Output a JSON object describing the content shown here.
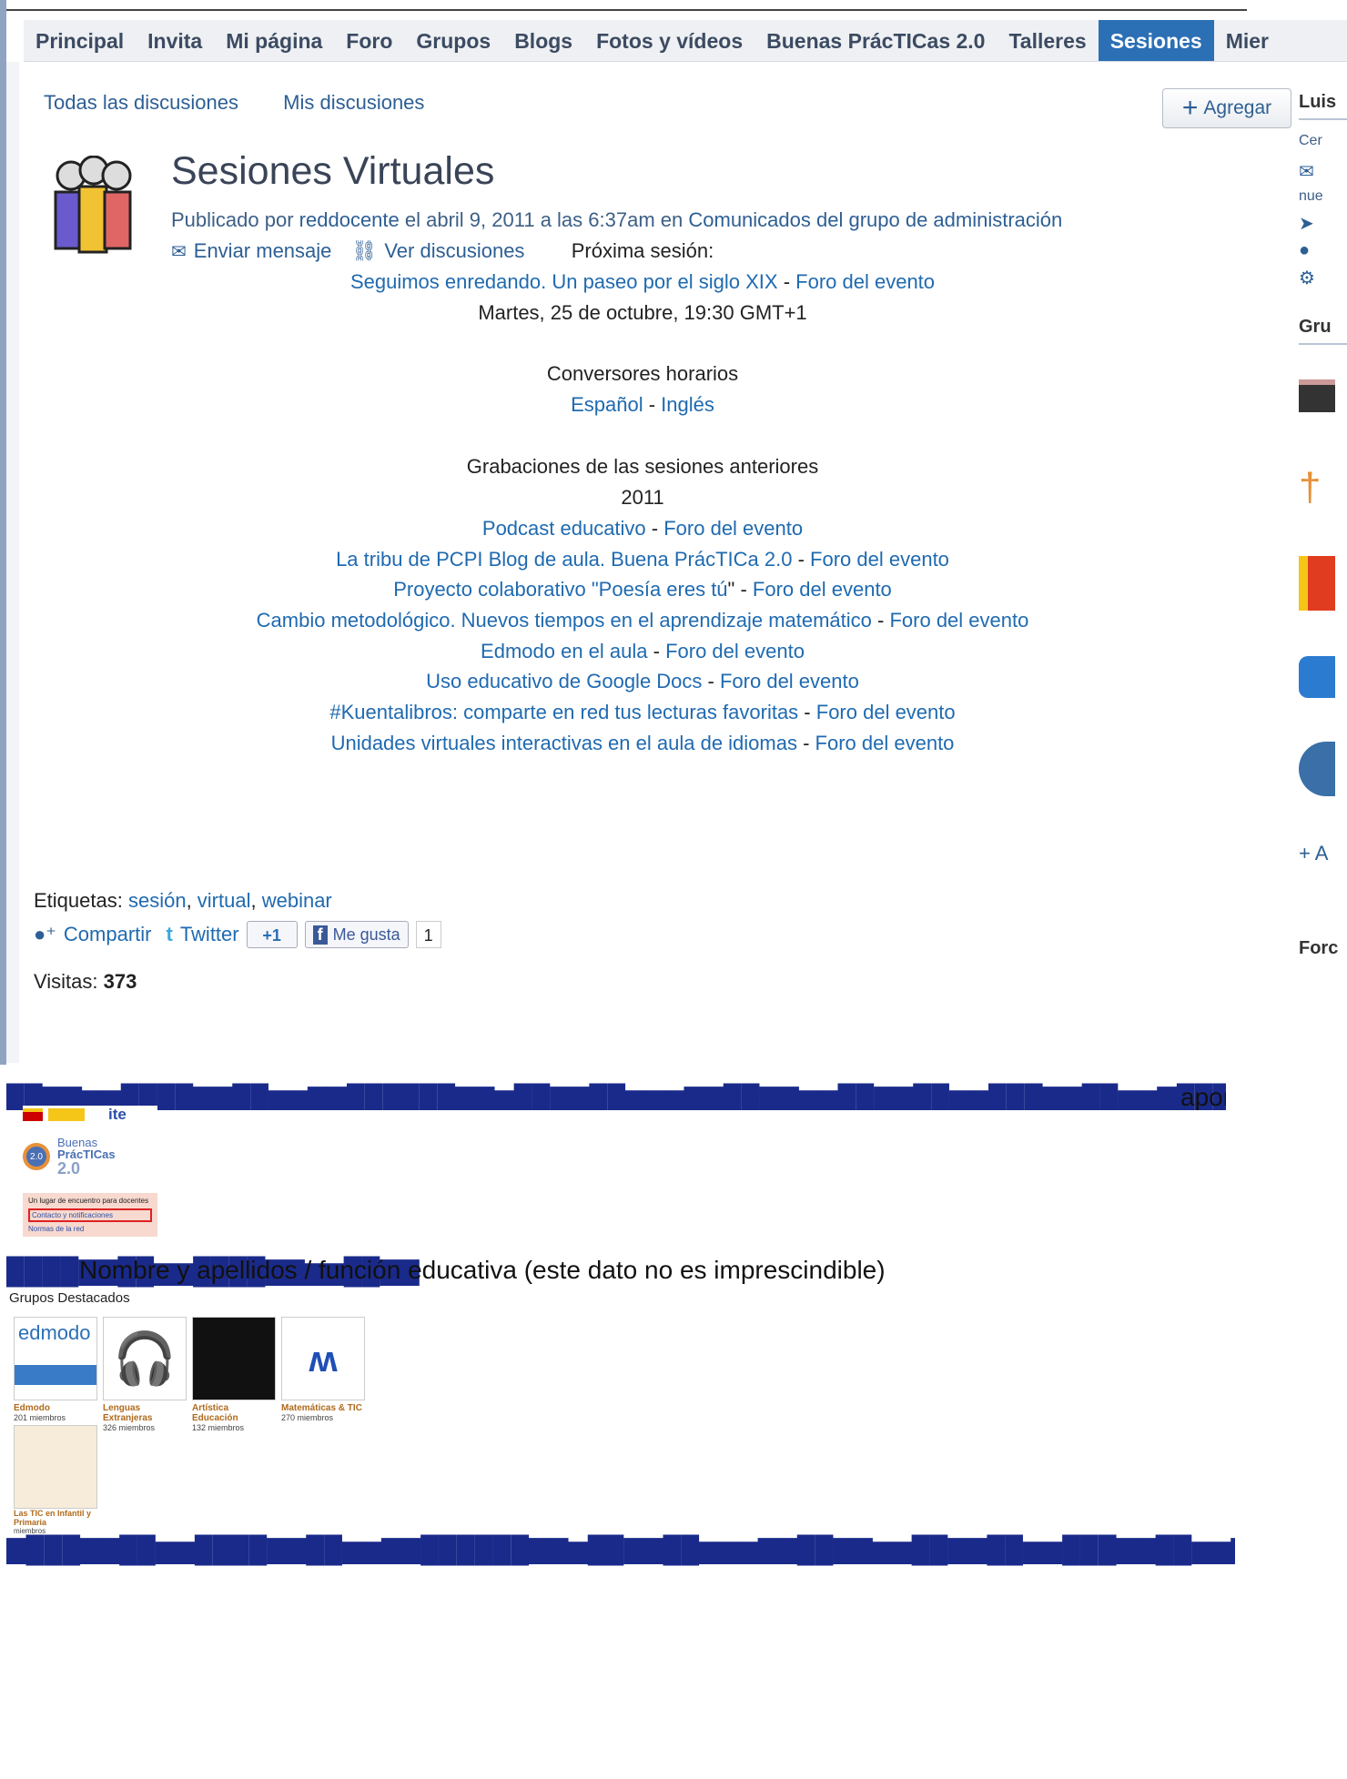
{
  "nav": [
    "Principal",
    "Invita",
    "Mi página",
    "Foro",
    "Grupos",
    "Blogs",
    "Fotos y vídeos",
    "Buenas PrácTICas 2.0",
    "Talleres",
    "Sesiones",
    "Mier"
  ],
  "subnav": {
    "all": "Todas las discusiones",
    "mine": "Mis discusiones"
  },
  "add_button": "Agregar",
  "post": {
    "title": "Sesiones Virtuales",
    "by_prefix": "Publicado por",
    "author": "reddocente",
    "date": "el abril 9, 2011 a las 6:37am en",
    "category": "Comunicados del grupo de administración",
    "send_message": "Enviar mensaje",
    "view_discussions": "Ver discusiones"
  },
  "next": {
    "heading": "Próxima sesión:",
    "title": "Seguimos enredando. Un paseo por el siglo XIX",
    "forum": "Foro del evento",
    "datetime": "Martes, 25 de octubre, 19:30 GMT+1"
  },
  "converters": {
    "heading": "Conversores horarios",
    "es": "Español",
    "en": "Inglés"
  },
  "recordings": {
    "heading": "Grabaciones de las sesiones anteriores",
    "year": "2011",
    "items": [
      {
        "title": "Podcast educativo",
        "forum": "Foro del evento"
      },
      {
        "title": "La tribu de PCPI Blog de aula. Buena PrácTICa 2.0",
        "forum": "Foro del evento"
      },
      {
        "title": "Proyecto colaborativo \"Poesía eres tú",
        "suffix": "\"",
        "forum": "Foro del evento"
      },
      {
        "title": "Cambio metodológico. Nuevos tiempos en el aprendizaje matemático",
        "forum": "Foro del evento"
      },
      {
        "title": "Edmodo en el aula",
        "forum": "Foro del evento"
      },
      {
        "title": "Uso educativo de Google Docs",
        "forum": "Foro del evento"
      },
      {
        "title": "#Kuentalibros: comparte en red tus lecturas favoritas",
        "forum": "Foro del evento"
      },
      {
        "title": "Unidades virtuales interactivas en el aula de idiomas",
        "forum": "Foro del evento"
      }
    ]
  },
  "tags": {
    "label": "Etiquetas:",
    "items": [
      "sesión",
      "virtual",
      "webinar"
    ]
  },
  "share": {
    "compartir": "Compartir",
    "twitter": "Twitter",
    "gplus": "+1",
    "like": "Me gusta",
    "like_count": "1"
  },
  "visits": {
    "label": "Visitas:",
    "value": "373"
  },
  "right": {
    "user": "Luis",
    "c1": "Cer",
    "c2": "nue",
    "groups": "Gru",
    "forum": "Forc",
    "add": "+ A"
  },
  "garble": {
    "line1": "aportar",
    "line2": "Nombre y apellidos / función educativa (este dato no es imprescindible)",
    "line3": "Grupos Destacados"
  },
  "banner": {
    "logo": "ite",
    "title1": "Buenas",
    "title2": "PrácTICas",
    "title3": "2.0",
    "tagline": "Un lugar de encuentro para docentes",
    "link1": "Contacto y notificaciones",
    "link2": "Normas de la red"
  },
  "groups": [
    {
      "name": "Edmodo",
      "members": "201 miembros"
    },
    {
      "name": "Lenguas Extranjeras",
      "members": "326 miembros"
    },
    {
      "name": "Artística Educación",
      "members": "132 miembros"
    },
    {
      "name": "Matemáticas & TIC",
      "members": "270 miembros"
    }
  ],
  "group5": {
    "name": "Las TIC en Infantil y Primaria",
    "members": "miembros"
  },
  "colors": {
    "nav_active": "#2b6fb5",
    "link": "#1f6ab0",
    "heading": "#3a4458"
  }
}
